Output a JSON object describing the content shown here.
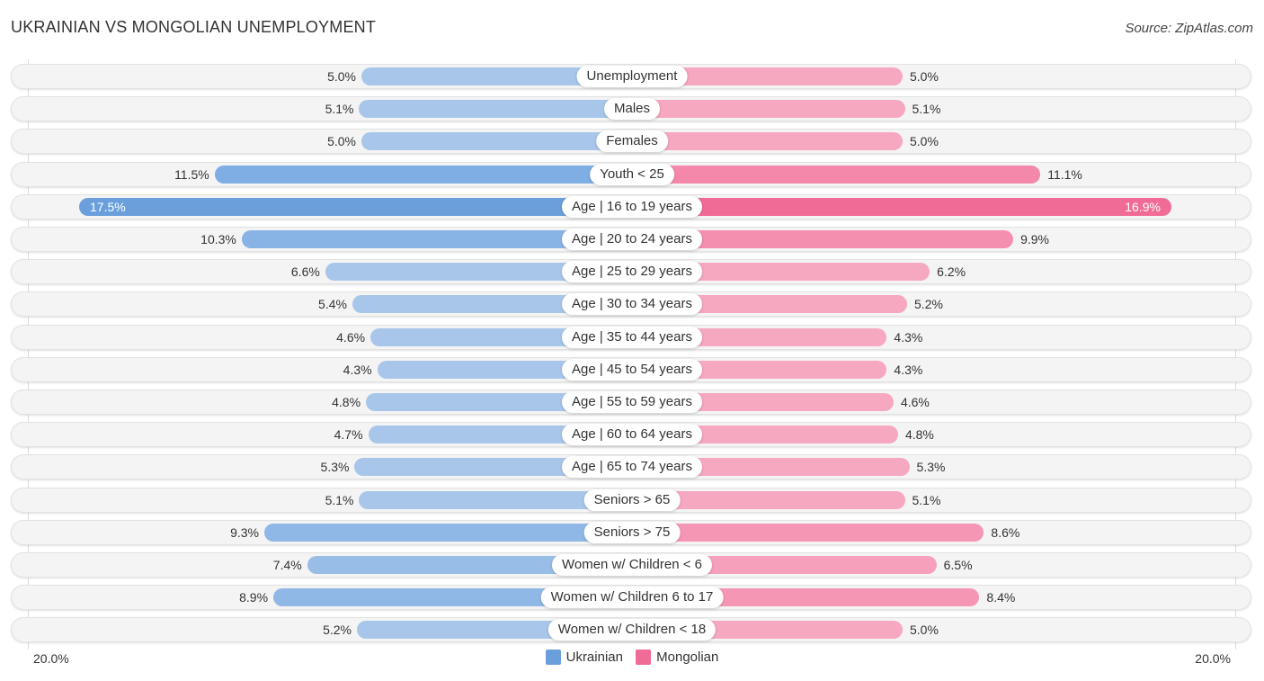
{
  "header": {
    "title": "UKRAINIAN VS MONGOLIAN UNEMPLOYMENT",
    "source": "Source: ZipAtlas.com"
  },
  "chart_data": {
    "type": "bar",
    "orientation": "horizontal-diverging",
    "title": "UKRAINIAN VS MONGOLIAN UNEMPLOYMENT",
    "xlabel": "",
    "ylabel": "",
    "xlim": [
      0,
      20.0
    ],
    "axis_labels": {
      "left": "20.0%",
      "right": "20.0%"
    },
    "legend": {
      "placement": "bottom-center"
    },
    "categories": [
      "Unemployment",
      "Males",
      "Females",
      "Youth < 25",
      "Age | 16 to 19 years",
      "Age | 20 to 24 years",
      "Age | 25 to 29 years",
      "Age | 30 to 34 years",
      "Age | 35 to 44 years",
      "Age | 45 to 54 years",
      "Age | 55 to 59 years",
      "Age | 60 to 64 years",
      "Age | 65 to 74 years",
      "Seniors > 65",
      "Seniors > 75",
      "Women w/ Children < 6",
      "Women w/ Children 6 to 17",
      "Women w/ Children < 18"
    ],
    "series": [
      {
        "name": "Ukrainian",
        "color": "#6a9fdc",
        "side": "left",
        "values": [
          5.0,
          5.1,
          5.0,
          11.5,
          17.5,
          10.3,
          6.6,
          5.4,
          4.6,
          4.3,
          4.8,
          4.7,
          5.3,
          5.1,
          9.3,
          7.4,
          8.9,
          5.2
        ],
        "labels": [
          "5.0%",
          "5.1%",
          "5.0%",
          "11.5%",
          "17.5%",
          "10.3%",
          "6.6%",
          "5.4%",
          "4.6%",
          "4.3%",
          "4.8%",
          "4.7%",
          "5.3%",
          "5.1%",
          "9.3%",
          "7.4%",
          "8.9%",
          "5.2%"
        ]
      },
      {
        "name": "Mongolian",
        "color": "#f06b96",
        "side": "right",
        "values": [
          5.0,
          5.1,
          5.0,
          11.1,
          16.9,
          9.9,
          6.2,
          5.2,
          4.3,
          4.3,
          4.6,
          4.8,
          5.3,
          5.1,
          8.6,
          6.5,
          8.4,
          5.0
        ],
        "labels": [
          "5.0%",
          "5.1%",
          "5.0%",
          "11.1%",
          "16.9%",
          "9.9%",
          "6.2%",
          "5.2%",
          "4.3%",
          "4.3%",
          "4.6%",
          "4.8%",
          "5.3%",
          "5.1%",
          "8.6%",
          "6.5%",
          "8.4%",
          "5.0%"
        ]
      }
    ]
  }
}
